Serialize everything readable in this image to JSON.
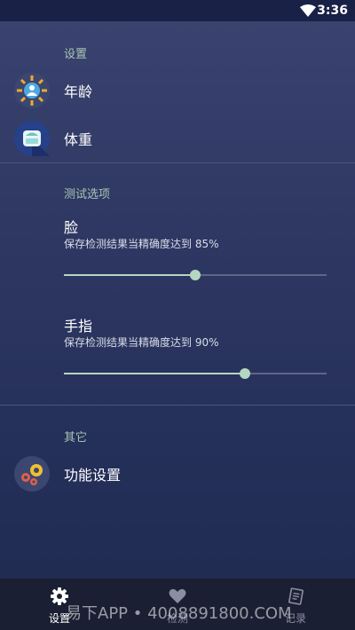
{
  "status_bar": {
    "time": "3:36"
  },
  "sections": {
    "settings": {
      "title": "设置",
      "items": [
        {
          "label": "年龄",
          "icon": "age-icon"
        },
        {
          "label": "体重",
          "icon": "weight-scale-icon"
        }
      ]
    },
    "test_options": {
      "title": "测试选项",
      "face": {
        "title": "脸",
        "subtitle": "保存检测结果当精确度达到 85%",
        "value": 0.5
      },
      "finger": {
        "title": "手指",
        "subtitle": "保存检测结果当精确度达到 90%",
        "value": 0.69
      }
    },
    "other": {
      "title": "其它",
      "items": [
        {
          "label": "功能设置",
          "icon": "gears-icon"
        }
      ]
    }
  },
  "bottom_nav": {
    "items": [
      {
        "label": "设置",
        "icon": "gear-icon",
        "active": true
      },
      {
        "label": "检测",
        "icon": "heart-icon",
        "active": false
      },
      {
        "label": "记录",
        "icon": "clipboard-icon",
        "active": false
      }
    ]
  },
  "watermark": "易下APP • 4008891800.COM",
  "colors": {
    "accent": "#b5d6c0",
    "section_title": "#a9c4b5",
    "nav_bg": "#1b1f33"
  }
}
